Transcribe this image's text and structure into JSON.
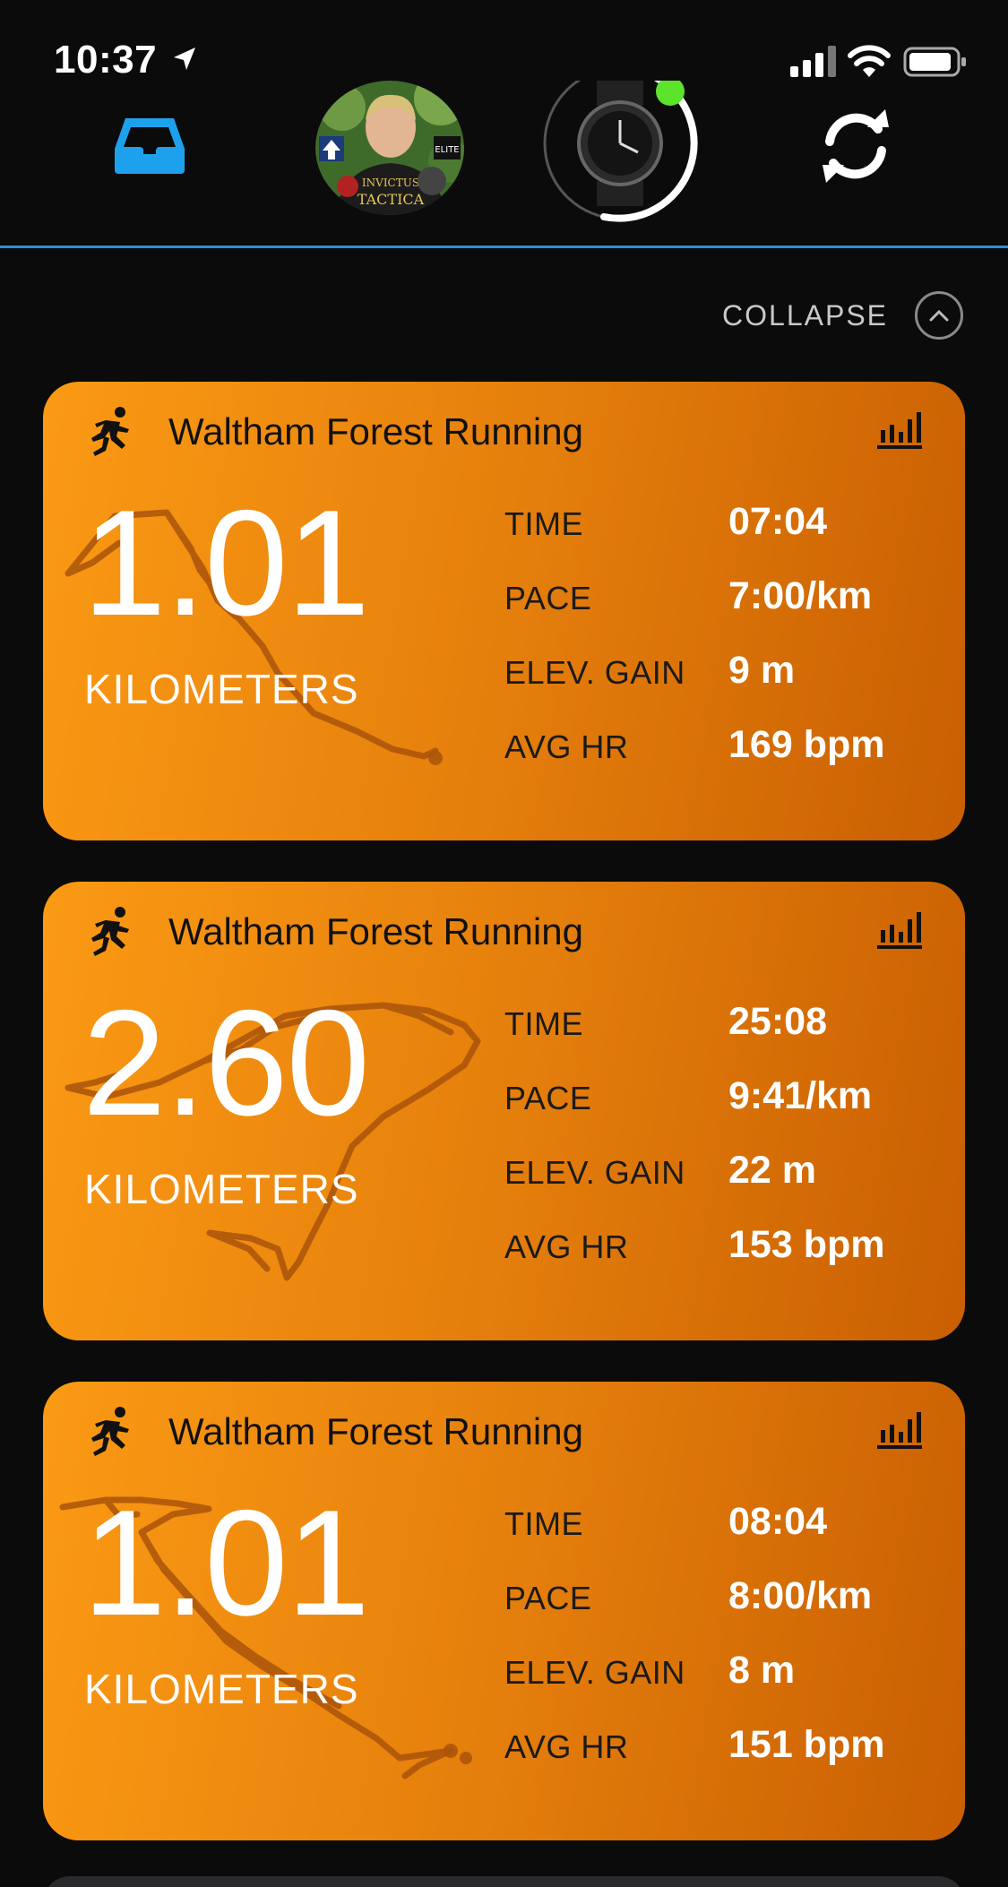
{
  "status_bar": {
    "time": "10:37",
    "icons": [
      "location-arrow-icon",
      "cellular-signal-icon",
      "wifi-icon",
      "battery-icon"
    ]
  },
  "top_nav": {
    "items": [
      "inbox-icon",
      "profile-avatar",
      "device-watch",
      "sync-icon"
    ],
    "accent_color": "#1ea1ec",
    "device_status_color": "#5ce32b"
  },
  "collapse": {
    "label": "COLLAPSE"
  },
  "activities": [
    {
      "title": "Waltham Forest Running",
      "distance": "1.01",
      "distance_unit": "KILOMETERS",
      "stats": [
        {
          "label": "TIME",
          "value": "07:04"
        },
        {
          "label": "PACE",
          "value": "7:00/km"
        },
        {
          "label": "ELEV. GAIN",
          "value": "9 m"
        },
        {
          "label": "AVG HR",
          "value": "169 bpm"
        }
      ]
    },
    {
      "title": "Waltham Forest Running",
      "distance": "2.60",
      "distance_unit": "KILOMETERS",
      "stats": [
        {
          "label": "TIME",
          "value": "25:08"
        },
        {
          "label": "PACE",
          "value": "9:41/km"
        },
        {
          "label": "ELEV. GAIN",
          "value": "22 m"
        },
        {
          "label": "AVG HR",
          "value": "153 bpm"
        }
      ]
    },
    {
      "title": "Waltham Forest Running",
      "distance": "1.01",
      "distance_unit": "KILOMETERS",
      "stats": [
        {
          "label": "TIME",
          "value": "08:04"
        },
        {
          "label": "PACE",
          "value": "8:00/km"
        },
        {
          "label": "ELEV. GAIN",
          "value": "8 m"
        },
        {
          "label": "AVG HR",
          "value": "151 bpm"
        }
      ]
    }
  ],
  "colors": {
    "background": "#0b0b0c",
    "card_gradient_start": "#fb9a14",
    "card_gradient_end": "#c95f02",
    "route_line": "#a9540a"
  }
}
